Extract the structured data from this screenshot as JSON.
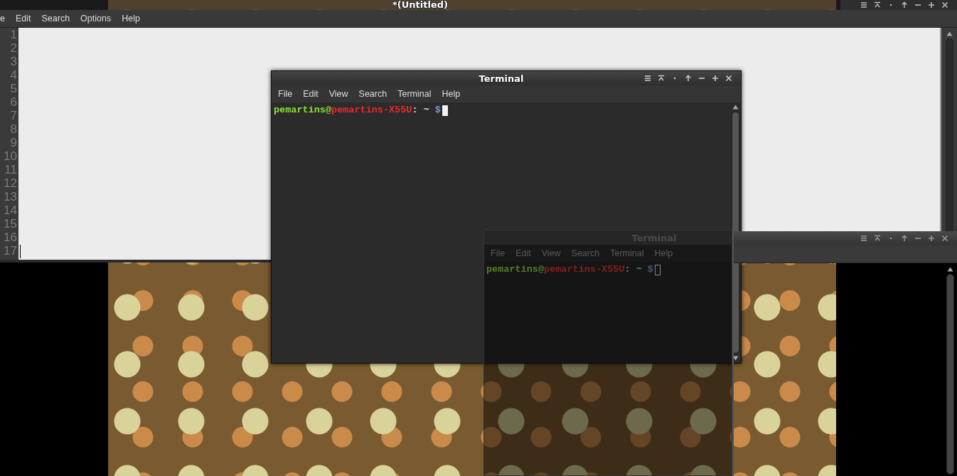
{
  "editor": {
    "title": "*(Untitled)",
    "menu": [
      "e",
      "Edit",
      "Search",
      "Options",
      "Help"
    ],
    "line_numbers": [
      "1",
      "2",
      "3",
      "4",
      "5",
      "6",
      "7",
      "8",
      "9",
      "10",
      "11",
      "12",
      "13",
      "14",
      "15",
      "16",
      "17"
    ]
  },
  "terminals": [
    {
      "title": "Terminal",
      "focused": true,
      "menu": [
        "File",
        "Edit",
        "View",
        "Search",
        "Terminal",
        "Help"
      ],
      "prompt": [
        {
          "text": "pemartins",
          "kind": "user"
        },
        {
          "text": "@",
          "kind": "user"
        },
        {
          "text": "pemartins-X55U",
          "kind": "host"
        },
        {
          "text": ": ~ ",
          "kind": "path"
        },
        {
          "text": "$",
          "kind": "sign"
        }
      ]
    },
    {
      "title": "Terminal",
      "focused": false,
      "menu": [
        "File",
        "Edit",
        "View",
        "Search",
        "Terminal",
        "Help"
      ],
      "prompt": [
        {
          "text": "pemartins",
          "kind": "user"
        },
        {
          "text": "@",
          "kind": "user"
        },
        {
          "text": "pemartins-X55U",
          "kind": "host"
        },
        {
          "text": ": ~ ",
          "kind": "path"
        },
        {
          "text": "$",
          "kind": "sign"
        }
      ]
    }
  ]
}
